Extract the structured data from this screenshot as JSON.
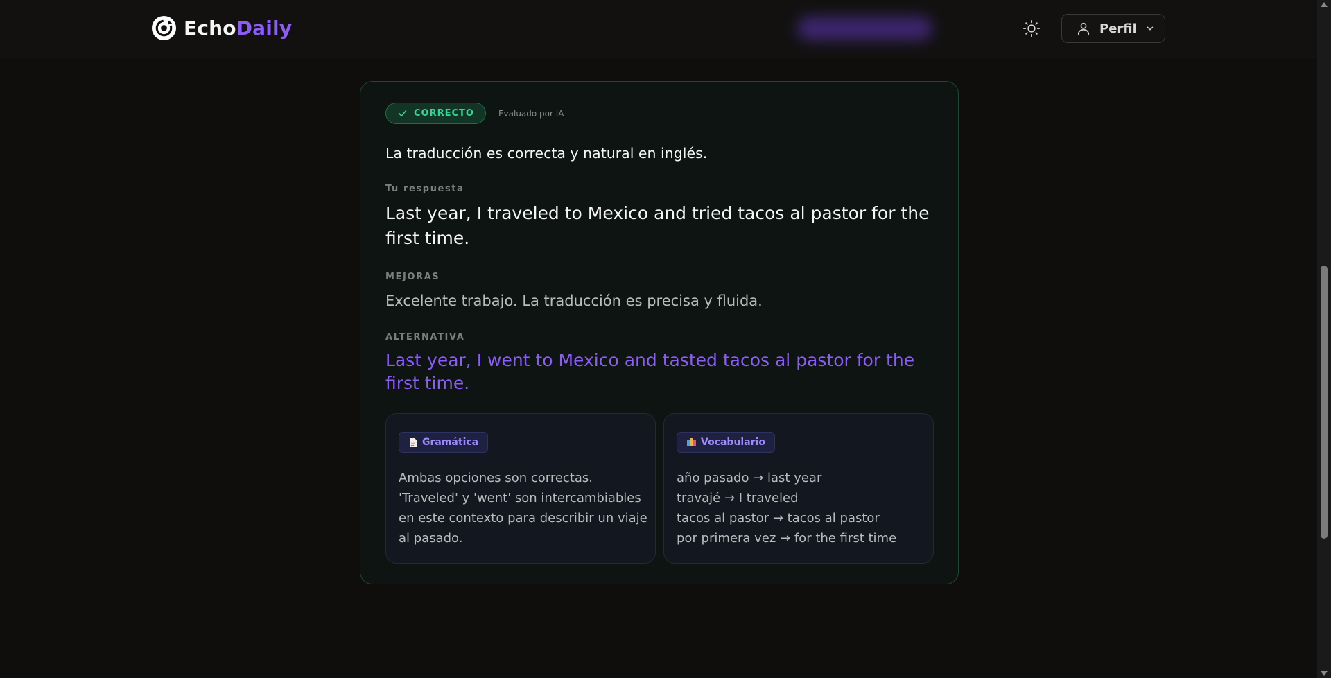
{
  "header": {
    "logo_part1": "Echo",
    "logo_part2": "Daily",
    "logo_icon": "echo-logo-icon",
    "theme_icon": "sun-icon",
    "profile": {
      "label": "Perfil",
      "icon": "user-icon",
      "chevron": "chevron-down-icon"
    }
  },
  "result": {
    "status_label": "CORRECTO",
    "status_icon": "check-icon",
    "evaluated_by": "Evaluado por IA",
    "summary": "La traducción es correcta y natural en inglés.",
    "your_answer_label": "Tu respuesta",
    "your_answer": "Last year, I traveled to Mexico and tried tacos al pastor for the first time.",
    "improvements_label": "MEJORAS",
    "improvements": "Excelente trabajo. La traducción es precisa y fluida.",
    "alternative_label": "ALTERNATIVA",
    "alternative": "Last year, I went to Mexico and tasted tacos al pastor for the first time."
  },
  "grammar": {
    "icon": "document-icon",
    "label": "Gramática",
    "text": "Ambas opciones son correctas. 'Traveled' y 'went' son intercambiables en este contexto para describir un viaje al pasado."
  },
  "vocabulary": {
    "icon": "books-icon",
    "label": "Vocabulario",
    "items": [
      "año pasado → last year",
      "travajé → I traveled",
      "tacos al pastor → tacos al pastor",
      "por primera vez → for the first time"
    ]
  },
  "colors": {
    "accent": "#8b5cf6",
    "success": "#34d399",
    "background": "#0f0e0d"
  }
}
